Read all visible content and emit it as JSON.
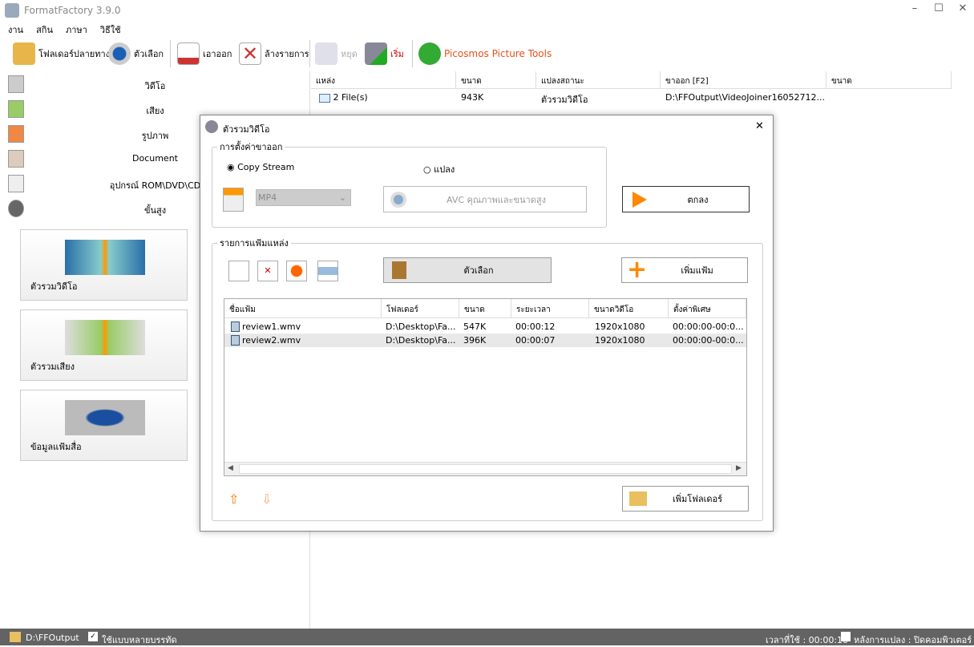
{
  "app": {
    "title": "FormatFactory 3.9.0",
    "window_controls": [
      "–",
      "☐",
      "✕"
    ]
  },
  "menu": [
    "งาน",
    "สกิน",
    "ภาษา",
    "วิธีใช้"
  ],
  "toolbar": {
    "output_folder": "โฟลเดอร์ปลายทาง",
    "options": "ตัวเลือก",
    "remove": "เอาออก",
    "clear": "ล้างรายการ",
    "stop": "หยุด",
    "start": "เริ่ม",
    "picosmos": "Picosmos Picture Tools"
  },
  "categories": [
    "วิดีโอ",
    "เสียง",
    "รูปภาพ",
    "Document",
    "อุปกรณ์ ROM\\DVD\\CD",
    "ขั้นสูง"
  ],
  "tiles": [
    "ตัวรวมวิดีโอ",
    "ตัวรวมเสียง",
    "ข้อมูลแฟ้มสื่อ"
  ],
  "grid": {
    "headers": [
      "แหล่ง",
      "ขนาด",
      "แปลงสถานะ",
      "ขาออก [F2]",
      "ขนาด"
    ],
    "row": [
      "2 File(s)",
      "943K",
      "ตัวรวมวิดีโอ",
      "D:\\FFOutput\\VideoJoiner16052712..."
    ]
  },
  "status": {
    "folder": "D:\\FFOutput",
    "multithread": "ใช้แบบหลายบรรทัด",
    "elapsed": "เวลาที่ใช้ : 00:00:10",
    "after": "หลังการแปลง : ปิดคอมพิวเตอร์"
  },
  "dialog": {
    "title": "ตัวรวมวิดีโอ",
    "close": "✕",
    "output_group": "การตั้งค่าขาออก",
    "copy_stream": "Copy Stream",
    "convert": "แปลง",
    "format": "MP4",
    "profile": "AVC คุณภาพและขนาดสูง",
    "ok": "ตกลง",
    "source_group": "รายการแฟ้มแหล่ง",
    "option": "ตัวเลือก",
    "add_file": "เพิ่มแฟ้ม",
    "add_folder": "เพิ่มโฟลเดอร์",
    "columns": [
      "ชื่อแฟ้ม",
      "โฟลเดอร์",
      "ขนาด",
      "ระยะเวลา",
      "ขนาดวิดีโอ",
      "ตั้งค่าพิเศษ"
    ],
    "files": [
      [
        "review1.wmv",
        "D:\\Desktop\\Fa...",
        "547K",
        "00:00:12",
        "1920x1080",
        "00:00:00-00:0..."
      ],
      [
        "review2.wmv",
        "D:\\Desktop\\Fa...",
        "396K",
        "00:00:07",
        "1920x1080",
        "00:00:00-00:0..."
      ]
    ]
  }
}
